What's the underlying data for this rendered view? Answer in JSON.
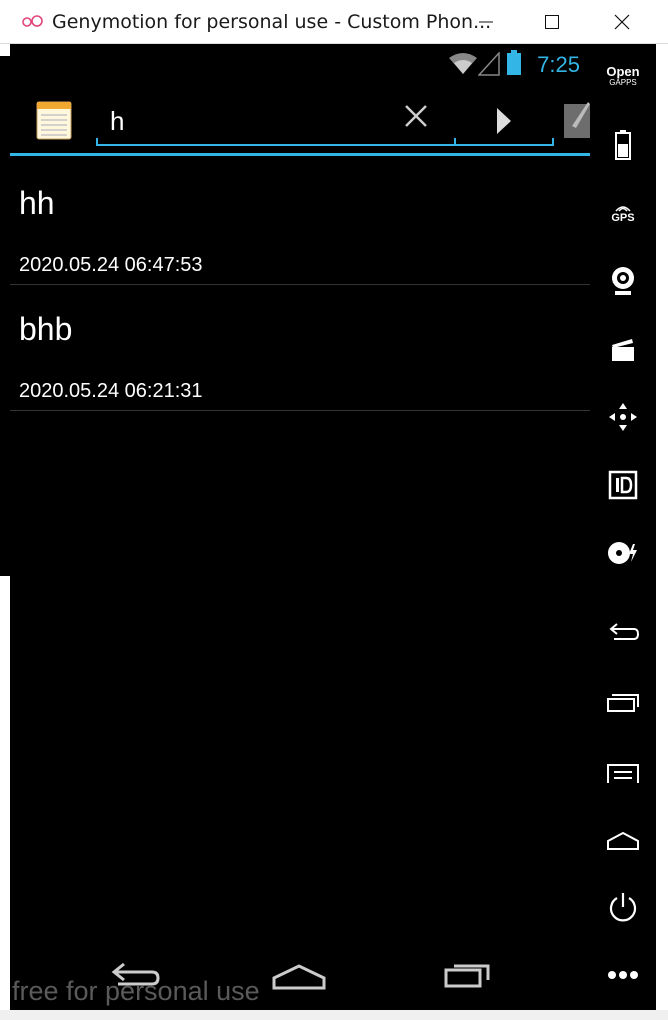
{
  "window": {
    "title": "Genymotion for personal use - Custom Phon...",
    "minimize_icon": "minimize-icon",
    "maximize_icon": "maximize-icon",
    "close_icon": "close-icon"
  },
  "status_bar": {
    "time": "7:25",
    "accent_color": "#33b5e5"
  },
  "search": {
    "query": "h",
    "clear_icon": "close-icon",
    "go_icon": "play-arrow-icon"
  },
  "notes": [
    {
      "title": "hh",
      "timestamp": "2020.05.24 06:47:53"
    },
    {
      "title": "bhb",
      "timestamp": "2020.05.24 06:21:31"
    }
  ],
  "sidebar": {
    "gapps_title": "Open",
    "gapps_subtitle": "GAPPS",
    "gps_label": "GPS"
  },
  "watermark": "free for personal use"
}
